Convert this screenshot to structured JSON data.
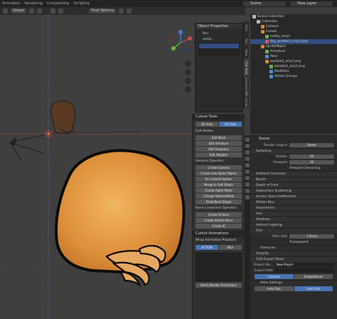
{
  "topbar": {
    "tabs": [
      "Animation",
      "Rendering",
      "Compositing",
      "Scripting"
    ],
    "scene": "Scene",
    "view_layer": "View Layer"
  },
  "viewport": {
    "header": {
      "orientation": "Global",
      "pivot": "Final Options"
    }
  },
  "object_properties": {
    "title": "Object Properties",
    "items": [
      "Bon",
      "zombi..."
    ],
    "list_rows": [
      "",
      ""
    ]
  },
  "side_tabs": [
    "Item",
    "Tool",
    "View",
    "COA Tools",
    "Extreme PBR Combo"
  ],
  "cutout_tools": {
    "title": "Cutout Tools",
    "view_toggle": [
      "3D View",
      "2D View"
    ],
    "edit_modes_label": "Edit Modes:",
    "edit_mode_buttons": [
      "Edit Mesh",
      "Edit Armature",
      "Edit Shapekey",
      "Edit Weights"
    ],
    "general_label": "General Operator:",
    "general_buttons": [
      "Create Camera",
      "Create new Sprite Object",
      "Re / Import Sprites",
      "Merge to Slot Object",
      "Create Alpha Mode",
      "Change Texture Mode",
      "Draw Bone Shape"
    ],
    "bone_label": "Bone Constraint Operator:",
    "bone_buttons": [
      "Create IK Bone",
      "Create Stretch Bone",
      "Create IK"
    ]
  },
  "cutout_animations": {
    "title": "Cutout Animations",
    "wrap_label": "Wrap Animation Playback",
    "action_tabs": [
      "ACTION",
      "NLA"
    ],
    "batch_button": "Batch Render Animations"
  },
  "outliner": {
    "rows": [
      {
        "label": "Scene Collection",
        "indent": 0,
        "color": "#bbbbbb"
      },
      {
        "label": "Collection",
        "indent": 1,
        "color": "#bbbbbb"
      },
      {
        "label": "Camera",
        "indent": 2,
        "color": "#d2893b"
      },
      {
        "label": "Cutout",
        "indent": 2,
        "color": "#d2893b"
      },
      {
        "label": "leafky_mesh",
        "indent": 3,
        "color": "#6fb04b"
      },
      {
        "label": "Big_zombie1_orly2.png",
        "indent": 3,
        "color": "#c25a5a"
      },
      {
        "label": "SpriteObject",
        "indent": 2,
        "color": "#d2893b"
      },
      {
        "label": "Armature",
        "indent": 3,
        "color": "#6fb04b"
      },
      {
        "label": "Pose",
        "indent": 3,
        "color": "#4f8fd0"
      },
      {
        "label": "zombie1_orly2.png",
        "indent": 3,
        "color": "#d2893b"
      },
      {
        "label": "zombie1_orly2.png",
        "indent": 4,
        "color": "#6fb04b"
      },
      {
        "label": "Modifiers",
        "indent": 4,
        "color": "#4f8fd0"
      },
      {
        "label": "Vertex Groups",
        "indent": 4,
        "color": "#4f8fd0"
      }
    ]
  },
  "properties": {
    "title": "Scene",
    "render_engine_label": "Render Engine",
    "render_engine": "Eevee",
    "sampling_label": "Sampling",
    "render_label": "Render",
    "render_value": "64",
    "viewport_label": "Viewport",
    "viewport_value": "16",
    "viewport_denoising": "Viewport Denoising",
    "panels": [
      "Ambient Occlusion",
      "Bloom",
      "Depth of Field",
      "Subsurface Scattering",
      "Screen Space Reflections",
      "Motion Blur",
      "Volumetrics",
      "Hair",
      "Shadows",
      "Indirect Lighting",
      "Film"
    ],
    "filter_size_label": "Filter Size",
    "filter_size_value": "1.50 px",
    "transparent_label": "Transparent",
    "overscan_label": "Overscan",
    "simplify_label": "Simplify",
    "coa_export_label": "COA Export Panel",
    "project_name_label": "Project Na...",
    "project_name_value": "New Project",
    "export_path_label": "Export Path",
    "export_tabs": [
      "Creature",
      "Dragonbones"
    ],
    "atlas_settings_label": "Atlas Settings",
    "atlas_tabs": [
      "Auto Size",
      "Limit Size"
    ]
  }
}
